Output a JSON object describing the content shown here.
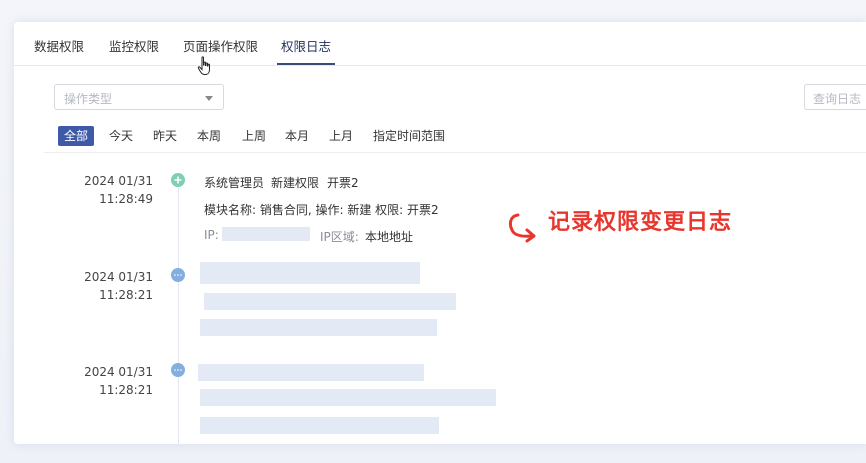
{
  "tabs": [
    {
      "label": "数据权限"
    },
    {
      "label": "监控权限"
    },
    {
      "label": "页面操作权限"
    },
    {
      "label": "权限日志"
    }
  ],
  "filters": {
    "operation_type_placeholder": "操作类型",
    "search_label": "查询日志"
  },
  "date_chips": [
    {
      "label": "全部"
    },
    {
      "label": "今天"
    },
    {
      "label": "昨天"
    },
    {
      "label": "本周"
    },
    {
      "label": "上周"
    },
    {
      "label": "本月"
    },
    {
      "label": "上月"
    },
    {
      "label": "指定时间范围"
    }
  ],
  "log_entries": [
    {
      "date": "2024 01/31",
      "time": "11:28:49",
      "user": "系统管理员",
      "action": "新建权限",
      "target": "开票2",
      "detail": "模块名称: 销售合同, 操作: 新建 权限: 开票2",
      "ip_label": "IP:",
      "region_label": "IP区域:",
      "region_value": "本地地址"
    },
    {
      "date": "2024 01/31",
      "time": "11:28:21"
    },
    {
      "date": "2024 01/31",
      "time": "11:28:21"
    }
  ],
  "annotation": {
    "text": "记录权限变更日志",
    "color": "#e8362d"
  },
  "colors": {
    "accent": "#3e59a7",
    "dot_green": "#7ecfb6",
    "dot_blue": "#84aee0"
  }
}
